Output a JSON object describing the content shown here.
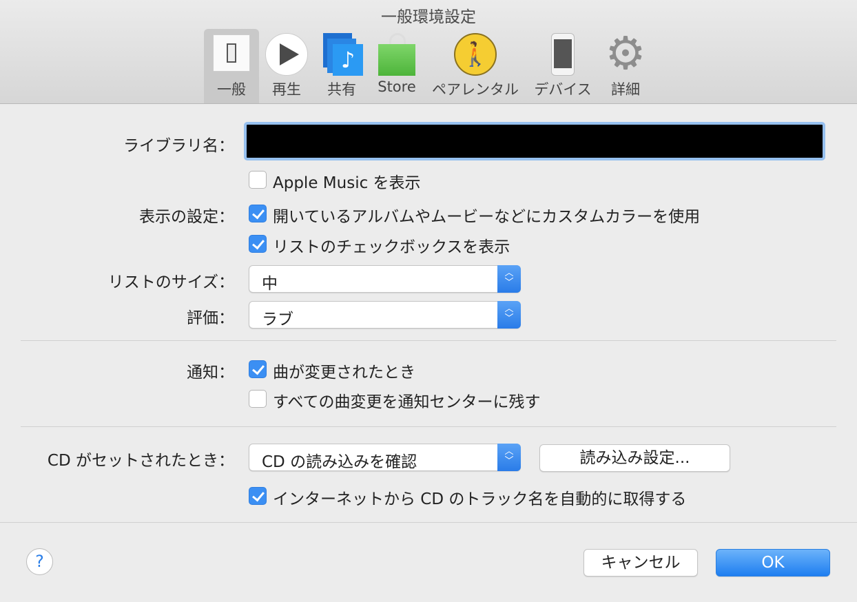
{
  "window": {
    "title": "一般環境設定"
  },
  "tabs": [
    {
      "label": "一般",
      "icon": "switch-icon",
      "selected": true
    },
    {
      "label": "再生",
      "icon": "play-icon"
    },
    {
      "label": "共有",
      "icon": "music-share-icon"
    },
    {
      "label": "Store",
      "icon": "shopping-bag-icon"
    },
    {
      "label": "ペアレンタル",
      "icon": "parental-icon"
    },
    {
      "label": "デバイス",
      "icon": "iphone-icon"
    },
    {
      "label": "詳細",
      "icon": "gear-icon"
    }
  ],
  "library": {
    "label": "ライブラリ名：",
    "value": ""
  },
  "apple_music": {
    "label": "Apple Music を表示",
    "checked": false
  },
  "display": {
    "label": "表示の設定：",
    "options": [
      {
        "label": "開いているアルバムやムービーなどにカスタムカラーを使用",
        "checked": true
      },
      {
        "label": "リストのチェックボックスを表示",
        "checked": true
      }
    ]
  },
  "list_size": {
    "label": "リストのサイズ：",
    "value": "中"
  },
  "rating": {
    "label": "評価：",
    "value": "ラブ"
  },
  "notify": {
    "label": "通知：",
    "options": [
      {
        "label": "曲が変更されたとき",
        "checked": true
      },
      {
        "label": "すべての曲変更を通知センターに残す",
        "checked": false
      }
    ]
  },
  "cd": {
    "label": "CD がセットされたとき：",
    "value": "CD の読み込みを確認",
    "import_button": "読み込み設定...",
    "auto_name": {
      "label": "インターネットから CD のトラック名を自動的に取得する",
      "checked": true
    }
  },
  "footer": {
    "help": "?",
    "cancel": "キャンセル",
    "ok": "OK"
  }
}
